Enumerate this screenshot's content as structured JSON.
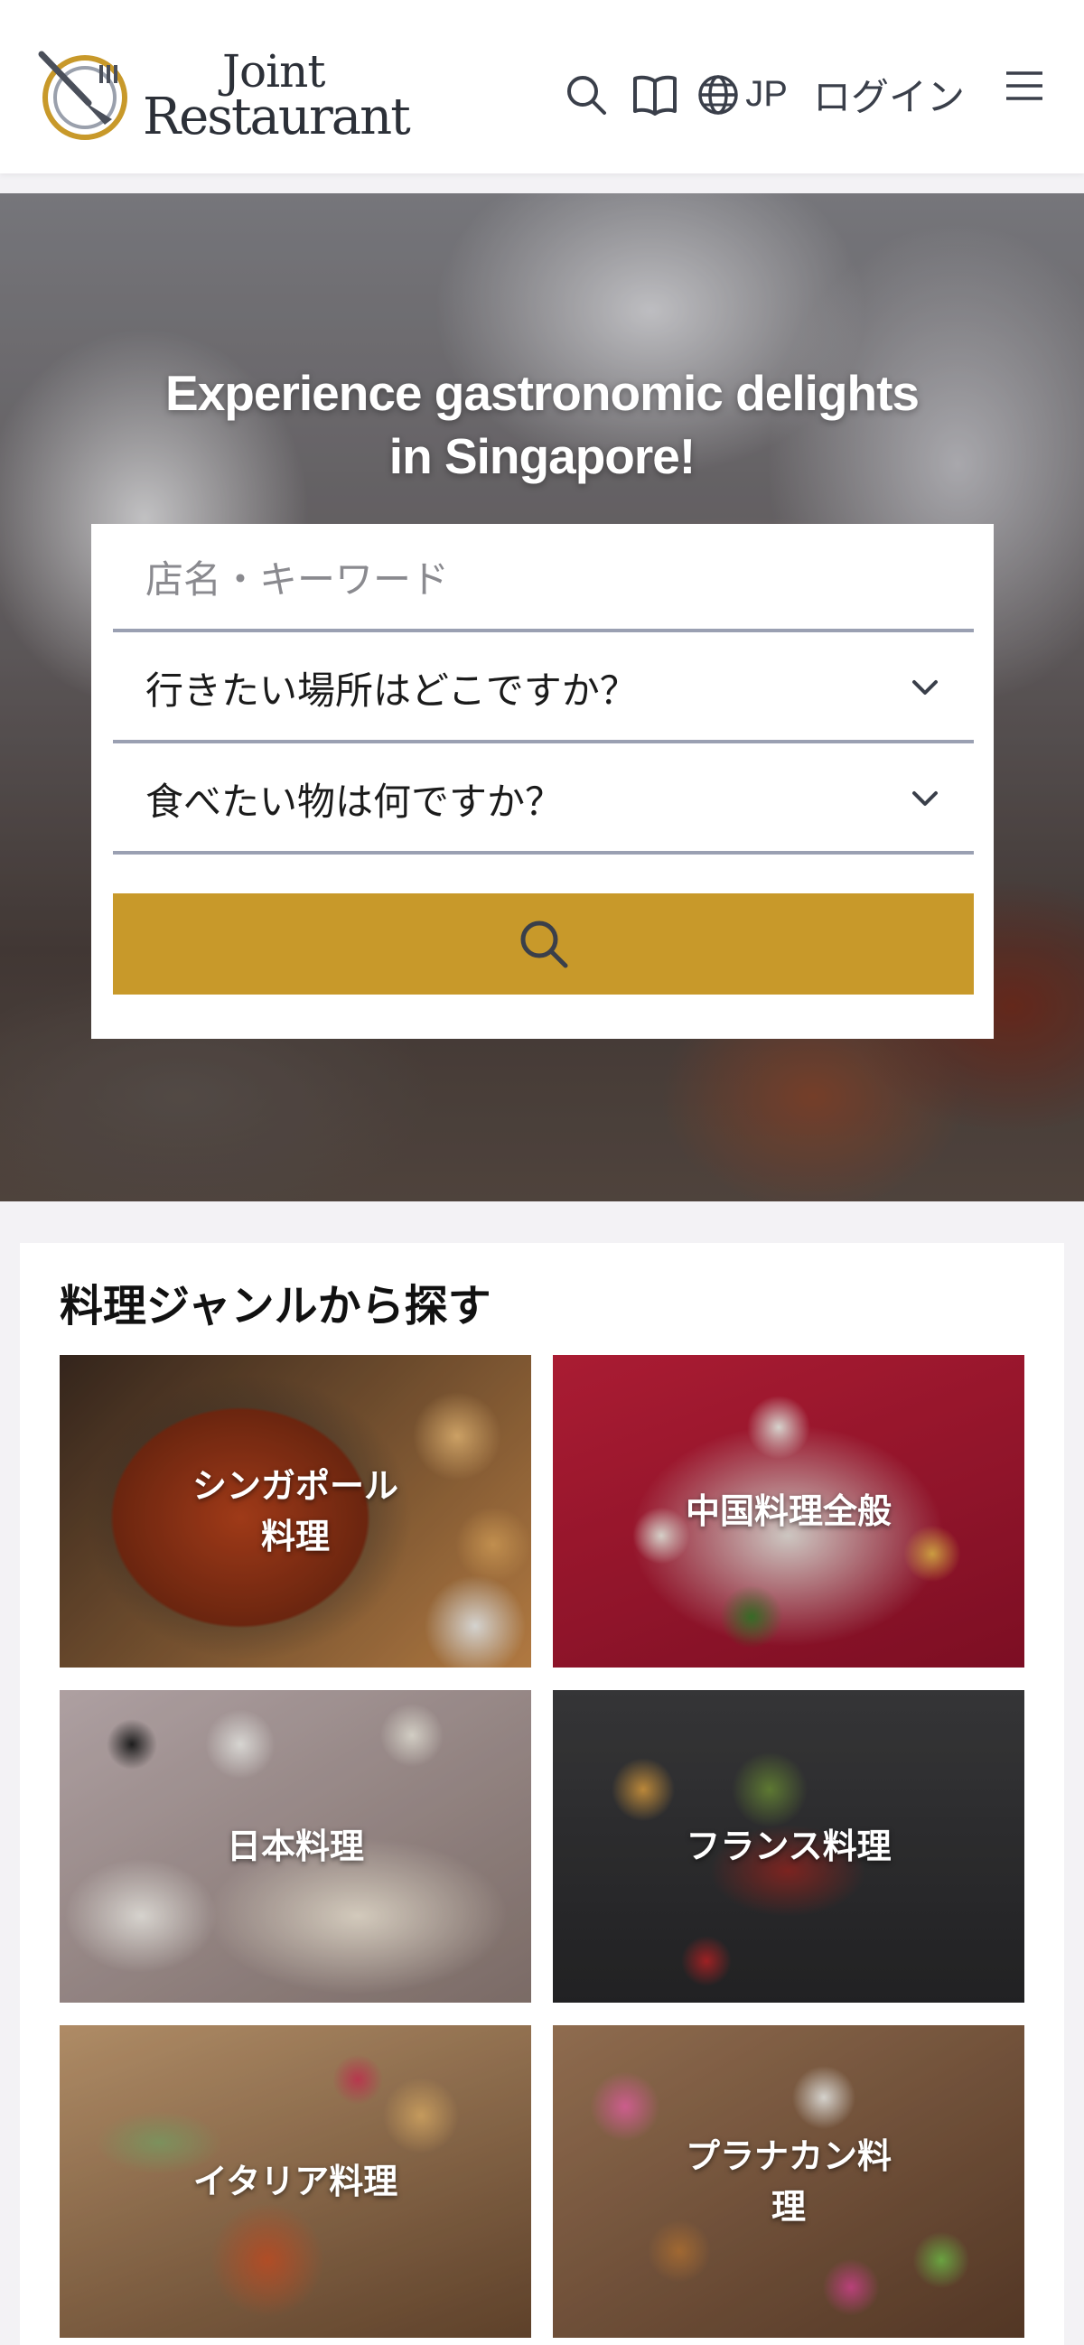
{
  "header": {
    "logo_line1": "Joint",
    "logo_line2": "Restaurant",
    "language": "JP",
    "login": "ログイン",
    "icons": [
      "search-icon",
      "book-icon",
      "globe-icon",
      "hamburger-menu-icon"
    ]
  },
  "hero": {
    "title_line1": "Experience gastronomic delights",
    "title_line2": "in Singapore!"
  },
  "search": {
    "keyword_placeholder": "店名・キーワード",
    "area_select": "行きたい場所はどこですか？",
    "food_select": "食べたい物は何ですか？",
    "button_icon": "search-icon"
  },
  "genres": {
    "title": "料理ジャンルから探す",
    "items": [
      {
        "label": "シンガポール料理"
      },
      {
        "label": "中国料理全般"
      },
      {
        "label": "日本料理"
      },
      {
        "label": "フランス料理"
      },
      {
        "label": "イタリア料理"
      },
      {
        "label": "プラナカン料理"
      }
    ]
  },
  "colors": {
    "accent_gold": "#c8992a",
    "logo_ring": "#c8992a",
    "text_dark": "#2c3038"
  }
}
